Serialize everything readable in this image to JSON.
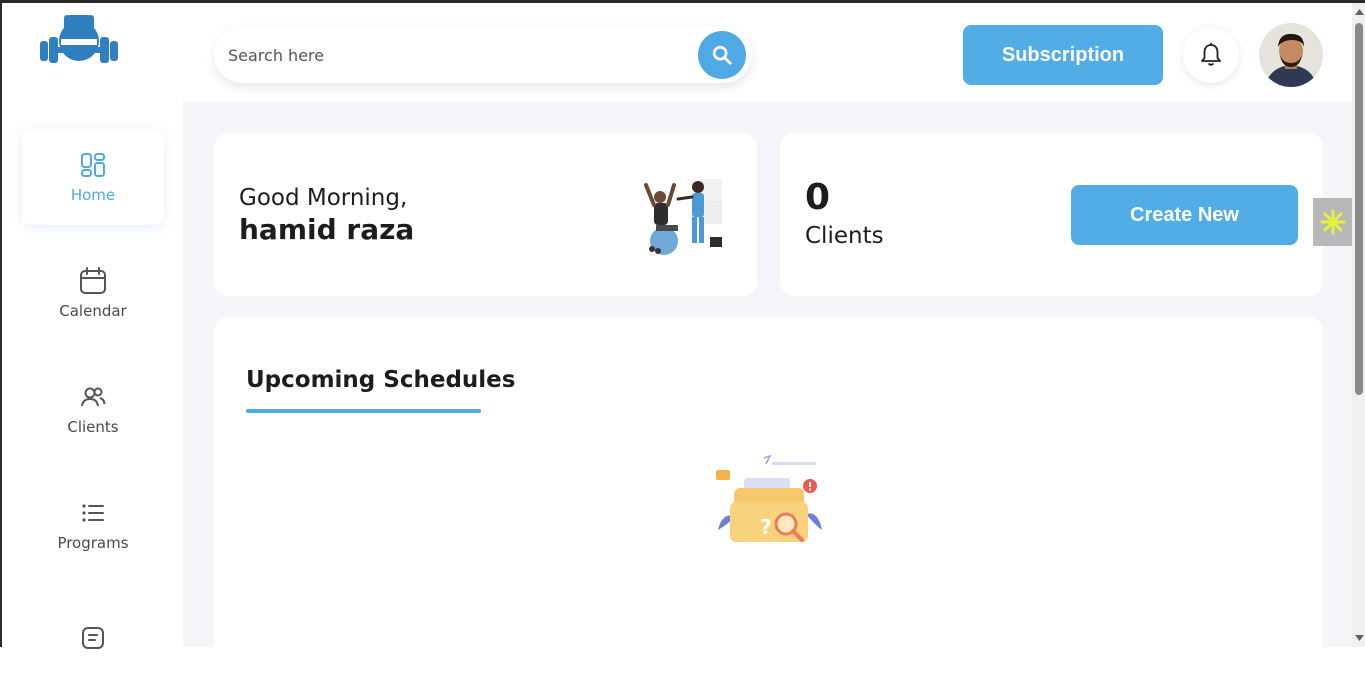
{
  "header": {
    "search": {
      "placeholder": "Search here",
      "value": ""
    },
    "subscription_label": "Subscription"
  },
  "sidebar": {
    "items": [
      {
        "label": "Home",
        "icon": "dashboard-icon",
        "active": true
      },
      {
        "label": "Calendar",
        "icon": "calendar-icon",
        "active": false
      },
      {
        "label": "Clients",
        "icon": "users-icon",
        "active": false
      },
      {
        "label": "Programs",
        "icon": "list-icon",
        "active": false
      },
      {
        "label": "",
        "icon": "document-icon",
        "active": false
      }
    ]
  },
  "greeting": {
    "line1": "Good Morning,",
    "name": "hamid raza"
  },
  "clients": {
    "count": "0",
    "label": "Clients",
    "create_label": "Create New"
  },
  "schedules": {
    "title": "Upcoming Schedules"
  },
  "colors": {
    "accent": "#52ace6",
    "background": "#f6f5fa",
    "text": "#1d1d1f"
  }
}
